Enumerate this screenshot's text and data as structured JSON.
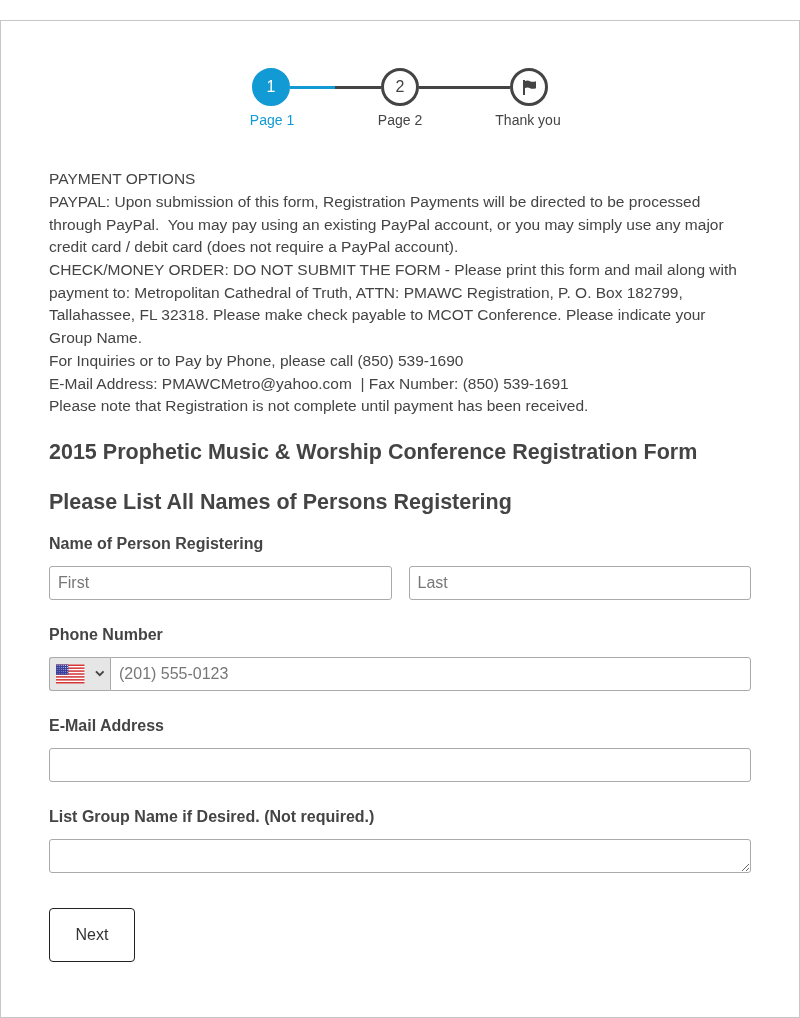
{
  "stepper": {
    "steps": [
      {
        "kind": "number",
        "number": "1",
        "label": "Page 1",
        "selected": true
      },
      {
        "kind": "number",
        "number": "2",
        "label": "Page 2",
        "selected": false
      },
      {
        "kind": "flag",
        "label": "Thank you",
        "selected": false
      }
    ]
  },
  "intro": {
    "title": "PAYMENT OPTIONS",
    "paragraphs": [
      "PAYPAL: Upon submission of this form, Registration Payments will be directed to be processed through PayPal.  You may pay using an existing PayPal account, or you may simply use any major credit card / debit card (does not require a PayPal account).",
      "CHECK/MONEY ORDER: DO NOT SUBMIT THE FORM - Please print this form and mail along with payment to: Metropolitan Cathedral of Truth, ATTN: PMAWC Registration, P. O. Box 182799, Tallahassee, FL 32318. Please make check payable to MCOT Conference. Please indicate your Group Name.",
      "For Inquiries or to Pay by Phone, please call (850) 539-1690",
      "E-Mail Address: PMAWCMetro@yahoo.com  | Fax Number: (850) 539-1691",
      "Please note that Registration is not complete until payment has been received."
    ]
  },
  "headings": [
    "2015 Prophetic Music & Worship Conference Registration Form",
    "Please List All Names of Persons Registering"
  ],
  "fields": [
    {
      "kind": "name",
      "label": "Name of Person Registering",
      "inputs": [
        {
          "placeholder": "First"
        },
        {
          "placeholder": "Last"
        }
      ]
    },
    {
      "kind": "phone",
      "label": "Phone Number",
      "placeholder": "(201) 555-0123"
    },
    {
      "kind": "text",
      "label": "E-Mail Address"
    },
    {
      "kind": "textarea",
      "label": "List Group Name if Desired. (Not required.)"
    }
  ],
  "buttons": [
    {
      "label": "Next"
    }
  ]
}
